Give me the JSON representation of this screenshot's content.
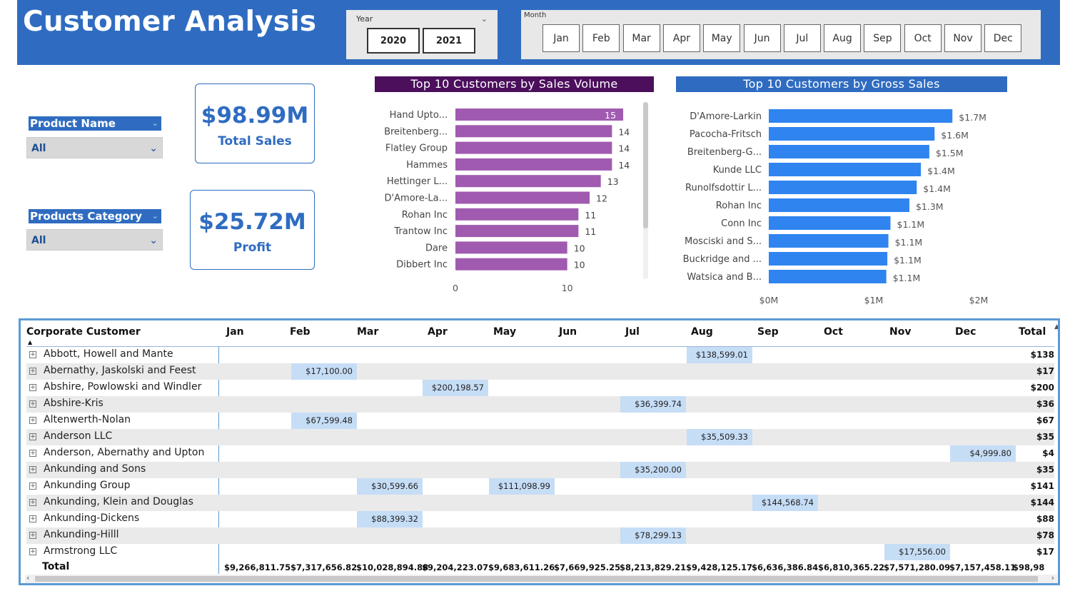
{
  "header": {
    "title": "Customer Analysis",
    "year_label": "Year",
    "years": [
      "2020",
      "2021"
    ],
    "month_label": "Month",
    "months": [
      "Jan",
      "Feb",
      "Mar",
      "Apr",
      "May",
      "Jun",
      "Jul",
      "Aug",
      "Sep",
      "Oct",
      "Nov",
      "Dec"
    ]
  },
  "filters": {
    "product_name": {
      "label": "Product Name",
      "value": "All"
    },
    "products_category": {
      "label": "Products Category",
      "value": "All"
    }
  },
  "kpis": {
    "total_sales": {
      "value": "$98.99M",
      "label": "Total Sales"
    },
    "profit": {
      "value": "$25.72M",
      "label": "Profit"
    }
  },
  "colors": {
    "brand": "#2f6cc1",
    "purple_header": "#4b0f5c",
    "purple_bar": "#a05bb0",
    "blue_bar": "#2f84f0",
    "cell_highlight": "#c6ddf6"
  },
  "chart_data": [
    {
      "type": "bar",
      "orientation": "horizontal",
      "title": "Top 10 Customers by Sales Volume",
      "categories": [
        "Hand Upto...",
        "Breitenberg...",
        "Flatley Group",
        "Hammes",
        "Hettinger L...",
        "D'Amore-La...",
        "Rohan Inc",
        "Trantow Inc",
        "Dare",
        "Dibbert Inc"
      ],
      "values": [
        15,
        14,
        14,
        14,
        13,
        12,
        11,
        11,
        10,
        10
      ],
      "data_labels": [
        "15",
        "14",
        "14",
        "14",
        "13",
        "12",
        "11",
        "11",
        "10",
        "10"
      ],
      "xticks": [
        "0",
        "10"
      ],
      "xlim": [
        0,
        15.7
      ],
      "grid": false
    },
    {
      "type": "bar",
      "orientation": "horizontal",
      "title": "Top 10 Customers by Gross Sales",
      "categories": [
        "D'Amore-Larkin",
        "Pacocha-Fritsch",
        "Breitenberg-G...",
        "Kunde LLC",
        "Runolfsdottir L...",
        "Rohan Inc",
        "Conn Inc",
        "Mosciski and S...",
        "Buckridge and ...",
        "Watsica and B..."
      ],
      "values": [
        1.75,
        1.58,
        1.53,
        1.45,
        1.41,
        1.34,
        1.16,
        1.14,
        1.13,
        1.12
      ],
      "data_labels": [
        "$1.7M",
        "$1.6M",
        "$1.5M",
        "$1.4M",
        "$1.4M",
        "$1.3M",
        "$1.1M",
        "$1.1M",
        "$1.1M",
        "$1.1M"
      ],
      "xticks": [
        "$0M",
        "$1M",
        "$2M"
      ],
      "xlim": [
        0,
        2
      ],
      "grid": false
    }
  ],
  "table": {
    "first_col": "Corporate Customer",
    "months": [
      "Jan",
      "Feb",
      "Mar",
      "Apr",
      "May",
      "Jun",
      "Jul",
      "Aug",
      "Sep",
      "Oct",
      "Nov",
      "Dec"
    ],
    "total_col": "Total",
    "rows": [
      {
        "name": "Abbott, Howell and Mante",
        "cells": [
          {
            "m": 7,
            "v": "$138,599.01"
          }
        ],
        "total": "$138"
      },
      {
        "name": "Abernathy, Jaskolski and Feest",
        "cells": [
          {
            "m": 1,
            "v": "$17,100.00"
          }
        ],
        "total": "$17"
      },
      {
        "name": "Abshire, Powlowski and Windler",
        "cells": [
          {
            "m": 3,
            "v": "$200,198.57"
          }
        ],
        "total": "$200"
      },
      {
        "name": "Abshire-Kris",
        "cells": [
          {
            "m": 6,
            "v": "$36,399.74"
          }
        ],
        "total": "$36"
      },
      {
        "name": "Altenwerth-Nolan",
        "cells": [
          {
            "m": 1,
            "v": "$67,599.48"
          }
        ],
        "total": "$67"
      },
      {
        "name": "Anderson LLC",
        "cells": [
          {
            "m": 7,
            "v": "$35,509.33"
          }
        ],
        "total": "$35"
      },
      {
        "name": "Anderson, Abernathy and Upton",
        "cells": [
          {
            "m": 11,
            "v": "$4,999.80"
          }
        ],
        "total": "$4"
      },
      {
        "name": "Ankunding and Sons",
        "cells": [
          {
            "m": 6,
            "v": "$35,200.00"
          }
        ],
        "total": "$35"
      },
      {
        "name": "Ankunding Group",
        "cells": [
          {
            "m": 2,
            "v": "$30,599.66"
          },
          {
            "m": 4,
            "v": "$111,098.99"
          }
        ],
        "total": "$141"
      },
      {
        "name": "Ankunding, Klein and Douglas",
        "cells": [
          {
            "m": 8,
            "v": "$144,568.74"
          }
        ],
        "total": "$144"
      },
      {
        "name": "Ankunding-Dickens",
        "cells": [
          {
            "m": 2,
            "v": "$88,399.32"
          }
        ],
        "total": "$88"
      },
      {
        "name": "Ankunding-Hilll",
        "cells": [
          {
            "m": 6,
            "v": "$78,299.13"
          }
        ],
        "total": "$78"
      },
      {
        "name": "Armstrong LLC",
        "cells": [
          {
            "m": 10,
            "v": "$17,556.00"
          }
        ],
        "total": "$17"
      }
    ],
    "total_label": "Total",
    "totals": [
      "$9,266,811.75",
      "$7,317,656.82",
      "$10,028,894.88",
      "$9,204,223.07",
      "$9,683,611.26",
      "$7,669,925.25",
      "$8,213,829.21",
      "$9,428,125.17",
      "$6,636,386.84",
      "$6,810,365.22",
      "$7,571,280.09",
      "$7,157,458.11",
      "$98,98"
    ]
  }
}
